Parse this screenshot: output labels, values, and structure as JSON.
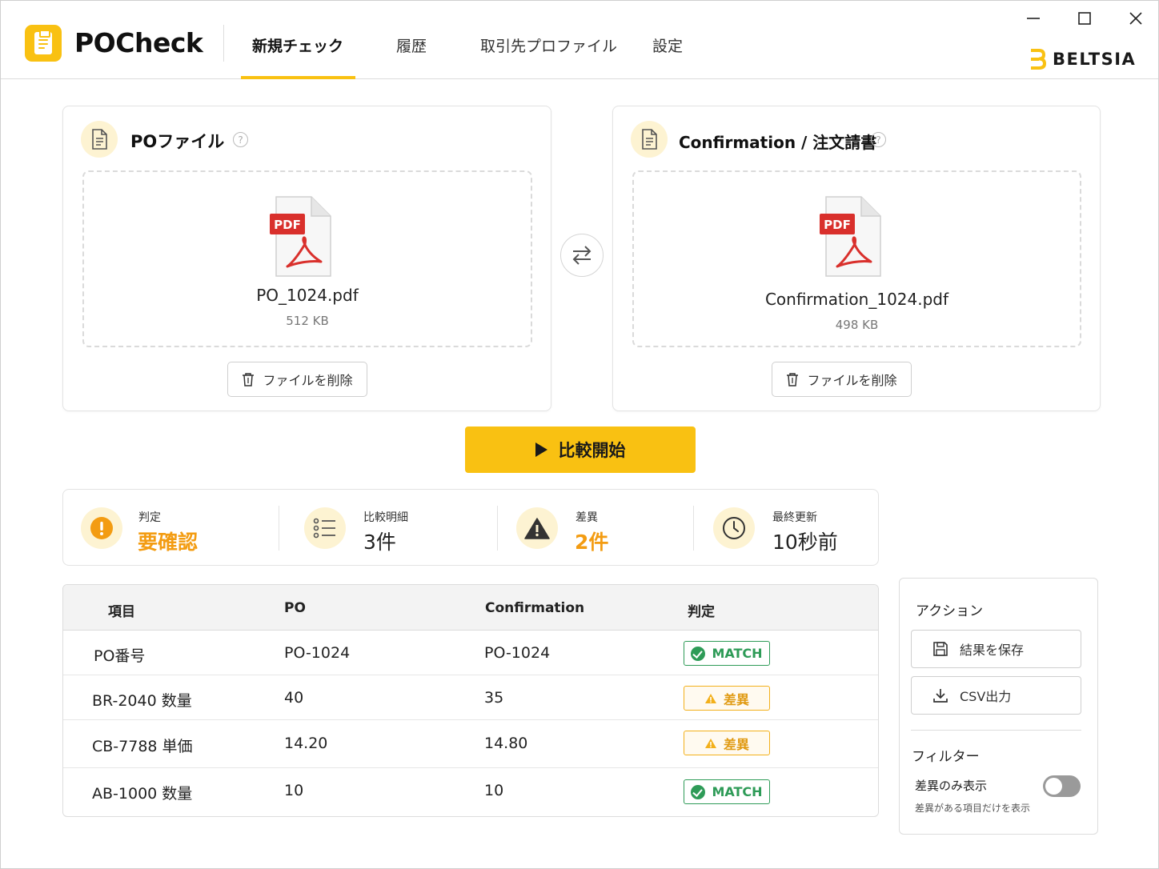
{
  "app": {
    "title": "POCheck",
    "brand": "BELTSIA"
  },
  "nav": {
    "tabs": [
      "新規チェック",
      "履歴",
      "取引先プロファイル",
      "設定"
    ],
    "active": 0
  },
  "colors": {
    "accent": "#f9c112",
    "match": "#2e9b57",
    "diff": "#f39c12",
    "pdf_red": "#d9302c"
  },
  "po_panel": {
    "title": "POファイル",
    "help": "?",
    "file_badge": "PDF",
    "file_name": "PO_1024.pdf",
    "file_size": "512 KB",
    "delete_label": "ファイルを削除"
  },
  "conf_panel": {
    "title": "Confirmation / 注文請書",
    "help": "?",
    "file_badge": "PDF",
    "file_name": "Confirmation_1024.pdf",
    "file_size": "498 KB",
    "delete_label": "ファイルを削除"
  },
  "start_button": "比較開始",
  "summary": {
    "judgement_label": "判定",
    "judgement_value": "要確認",
    "items_label": "比較明細",
    "items_value": "3件",
    "diff_label": "差異",
    "diff_value": "2件",
    "updated_label": "最終更新",
    "updated_value": "10秒前"
  },
  "table": {
    "headers": [
      "項目",
      "PO",
      "Confirmation",
      "判定"
    ],
    "rows": [
      {
        "item": "PO番号",
        "po": "PO-1024",
        "conf": "PO-1024",
        "status": "MATCH",
        "kind": "match"
      },
      {
        "item": "BR-2040 数量",
        "po": "40",
        "conf": "35",
        "status": "差異",
        "kind": "diff"
      },
      {
        "item": "CB-7788 単価",
        "po": "14.20",
        "conf": "14.80",
        "status": "差異",
        "kind": "diff"
      },
      {
        "item": "AB-1000 数量",
        "po": "10",
        "conf": "10",
        "status": "MATCH",
        "kind": "match"
      }
    ]
  },
  "actions": {
    "title": "アクション",
    "save_label": "結果を保存",
    "csv_label": "CSV出力",
    "filter_title": "フィルター",
    "diff_only_label": "差異のみ表示",
    "diff_only_hint": "差異がある項目だけを表示",
    "diff_only_enabled": false
  }
}
